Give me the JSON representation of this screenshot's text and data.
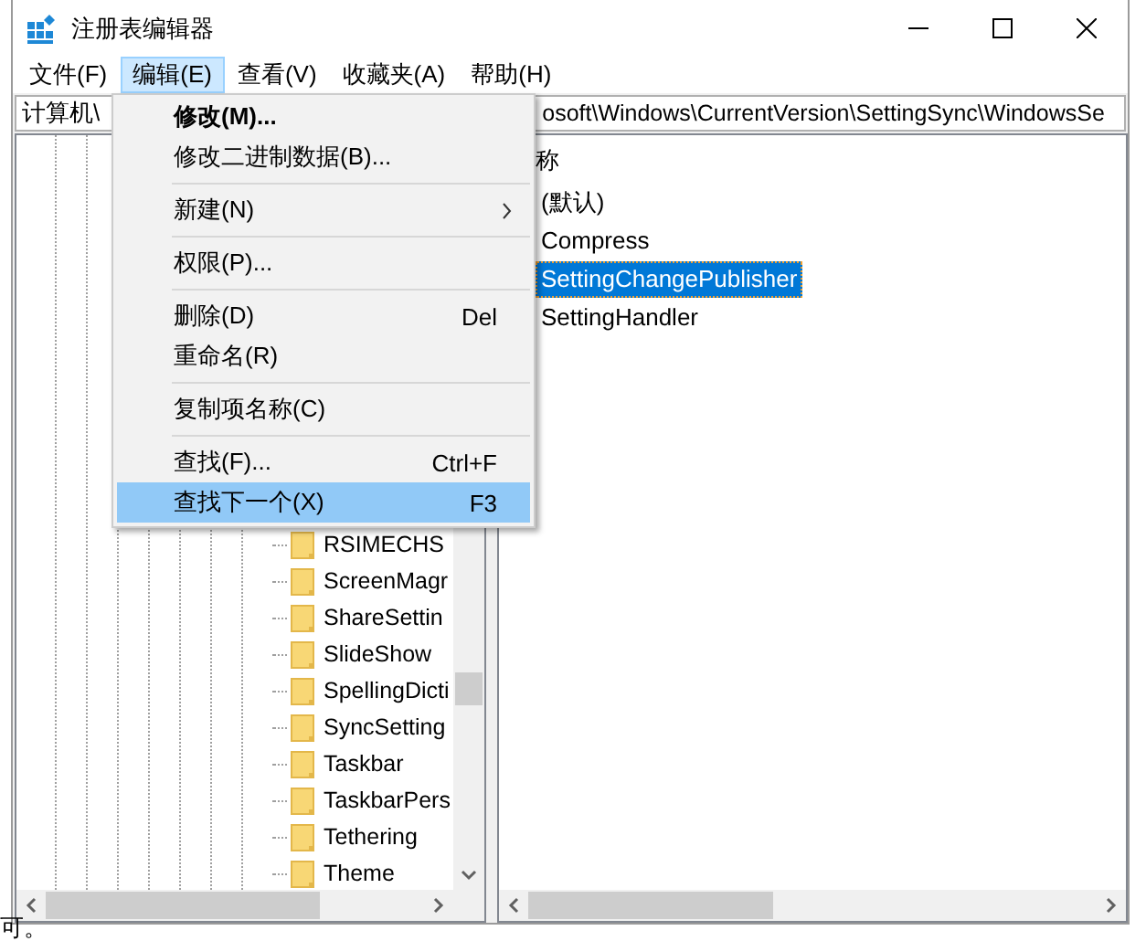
{
  "window": {
    "title": "注册表编辑器"
  },
  "menu_bar": [
    {
      "label": "文件(F)",
      "selected": false
    },
    {
      "label": "编辑(E)",
      "selected": true
    },
    {
      "label": "查看(V)",
      "selected": false
    },
    {
      "label": "收藏夹(A)",
      "selected": false
    },
    {
      "label": "帮助(H)",
      "selected": false
    }
  ],
  "address_bar": {
    "visible_parts": [
      "计算机\\",
      "osoft\\Windows\\CurrentVersion\\SettingSync\\WindowsSe"
    ]
  },
  "tree": {
    "items": [
      "RSIMECHS",
      "ScreenMagr",
      "ShareSettin",
      "SlideShow",
      "SpellingDicti",
      "SyncSetting",
      "Taskbar",
      "TaskbarPers",
      "Tethering",
      "Theme"
    ]
  },
  "values": {
    "column_header": "称",
    "rows": [
      {
        "name": "(默认)",
        "selected": false
      },
      {
        "name": "Compress",
        "selected": false
      },
      {
        "name": "SettingChangePublisher",
        "selected": true
      },
      {
        "name": "SettingHandler",
        "selected": false
      }
    ]
  },
  "edit_menu": {
    "items": [
      {
        "kind": "item",
        "label": "修改(M)...",
        "default": true,
        "selected": false
      },
      {
        "kind": "item",
        "label": "修改二进制数据(B)...",
        "selected": false
      },
      {
        "kind": "separator"
      },
      {
        "kind": "item",
        "label": "新建(N)",
        "submenu": true,
        "selected": false
      },
      {
        "kind": "separator"
      },
      {
        "kind": "item",
        "label": "权限(P)...",
        "selected": false
      },
      {
        "kind": "separator"
      },
      {
        "kind": "item",
        "label": "删除(D)",
        "shortcut": "Del",
        "selected": false
      },
      {
        "kind": "item",
        "label": "重命名(R)",
        "selected": false
      },
      {
        "kind": "separator"
      },
      {
        "kind": "item",
        "label": "复制项名称(C)",
        "selected": false
      },
      {
        "kind": "separator"
      },
      {
        "kind": "item",
        "label": "查找(F)...",
        "shortcut": "Ctrl+F",
        "selected": false
      },
      {
        "kind": "item",
        "label": "查找下一个(X)",
        "shortcut": "F3",
        "selected": true
      }
    ]
  },
  "background_text": "可。"
}
